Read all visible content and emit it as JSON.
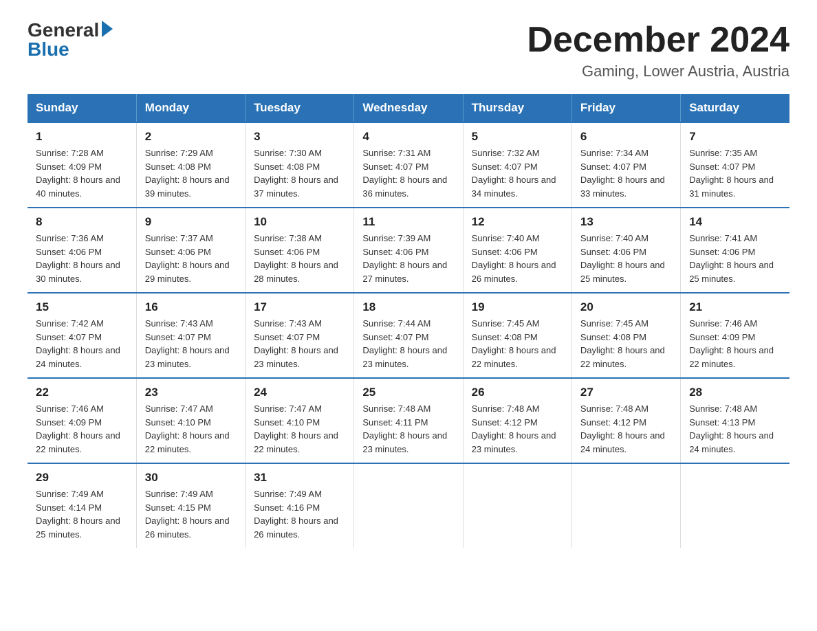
{
  "logo": {
    "general": "General",
    "blue": "Blue",
    "arrow": "▶"
  },
  "title": "December 2024",
  "location": "Gaming, Lower Austria, Austria",
  "weekdays": [
    "Sunday",
    "Monday",
    "Tuesday",
    "Wednesday",
    "Thursday",
    "Friday",
    "Saturday"
  ],
  "weeks": [
    [
      {
        "day": "1",
        "sunrise": "7:28 AM",
        "sunset": "4:09 PM",
        "daylight": "8 hours and 40 minutes."
      },
      {
        "day": "2",
        "sunrise": "7:29 AM",
        "sunset": "4:08 PM",
        "daylight": "8 hours and 39 minutes."
      },
      {
        "day": "3",
        "sunrise": "7:30 AM",
        "sunset": "4:08 PM",
        "daylight": "8 hours and 37 minutes."
      },
      {
        "day": "4",
        "sunrise": "7:31 AM",
        "sunset": "4:07 PM",
        "daylight": "8 hours and 36 minutes."
      },
      {
        "day": "5",
        "sunrise": "7:32 AM",
        "sunset": "4:07 PM",
        "daylight": "8 hours and 34 minutes."
      },
      {
        "day": "6",
        "sunrise": "7:34 AM",
        "sunset": "4:07 PM",
        "daylight": "8 hours and 33 minutes."
      },
      {
        "day": "7",
        "sunrise": "7:35 AM",
        "sunset": "4:07 PM",
        "daylight": "8 hours and 31 minutes."
      }
    ],
    [
      {
        "day": "8",
        "sunrise": "7:36 AM",
        "sunset": "4:06 PM",
        "daylight": "8 hours and 30 minutes."
      },
      {
        "day": "9",
        "sunrise": "7:37 AM",
        "sunset": "4:06 PM",
        "daylight": "8 hours and 29 minutes."
      },
      {
        "day": "10",
        "sunrise": "7:38 AM",
        "sunset": "4:06 PM",
        "daylight": "8 hours and 28 minutes."
      },
      {
        "day": "11",
        "sunrise": "7:39 AM",
        "sunset": "4:06 PM",
        "daylight": "8 hours and 27 minutes."
      },
      {
        "day": "12",
        "sunrise": "7:40 AM",
        "sunset": "4:06 PM",
        "daylight": "8 hours and 26 minutes."
      },
      {
        "day": "13",
        "sunrise": "7:40 AM",
        "sunset": "4:06 PM",
        "daylight": "8 hours and 25 minutes."
      },
      {
        "day": "14",
        "sunrise": "7:41 AM",
        "sunset": "4:06 PM",
        "daylight": "8 hours and 25 minutes."
      }
    ],
    [
      {
        "day": "15",
        "sunrise": "7:42 AM",
        "sunset": "4:07 PM",
        "daylight": "8 hours and 24 minutes."
      },
      {
        "day": "16",
        "sunrise": "7:43 AM",
        "sunset": "4:07 PM",
        "daylight": "8 hours and 23 minutes."
      },
      {
        "day": "17",
        "sunrise": "7:43 AM",
        "sunset": "4:07 PM",
        "daylight": "8 hours and 23 minutes."
      },
      {
        "day": "18",
        "sunrise": "7:44 AM",
        "sunset": "4:07 PM",
        "daylight": "8 hours and 23 minutes."
      },
      {
        "day": "19",
        "sunrise": "7:45 AM",
        "sunset": "4:08 PM",
        "daylight": "8 hours and 22 minutes."
      },
      {
        "day": "20",
        "sunrise": "7:45 AM",
        "sunset": "4:08 PM",
        "daylight": "8 hours and 22 minutes."
      },
      {
        "day": "21",
        "sunrise": "7:46 AM",
        "sunset": "4:09 PM",
        "daylight": "8 hours and 22 minutes."
      }
    ],
    [
      {
        "day": "22",
        "sunrise": "7:46 AM",
        "sunset": "4:09 PM",
        "daylight": "8 hours and 22 minutes."
      },
      {
        "day": "23",
        "sunrise": "7:47 AM",
        "sunset": "4:10 PM",
        "daylight": "8 hours and 22 minutes."
      },
      {
        "day": "24",
        "sunrise": "7:47 AM",
        "sunset": "4:10 PM",
        "daylight": "8 hours and 22 minutes."
      },
      {
        "day": "25",
        "sunrise": "7:48 AM",
        "sunset": "4:11 PM",
        "daylight": "8 hours and 23 minutes."
      },
      {
        "day": "26",
        "sunrise": "7:48 AM",
        "sunset": "4:12 PM",
        "daylight": "8 hours and 23 minutes."
      },
      {
        "day": "27",
        "sunrise": "7:48 AM",
        "sunset": "4:12 PM",
        "daylight": "8 hours and 24 minutes."
      },
      {
        "day": "28",
        "sunrise": "7:48 AM",
        "sunset": "4:13 PM",
        "daylight": "8 hours and 24 minutes."
      }
    ],
    [
      {
        "day": "29",
        "sunrise": "7:49 AM",
        "sunset": "4:14 PM",
        "daylight": "8 hours and 25 minutes."
      },
      {
        "day": "30",
        "sunrise": "7:49 AM",
        "sunset": "4:15 PM",
        "daylight": "8 hours and 26 minutes."
      },
      {
        "day": "31",
        "sunrise": "7:49 AM",
        "sunset": "4:16 PM",
        "daylight": "8 hours and 26 minutes."
      },
      null,
      null,
      null,
      null
    ]
  ]
}
